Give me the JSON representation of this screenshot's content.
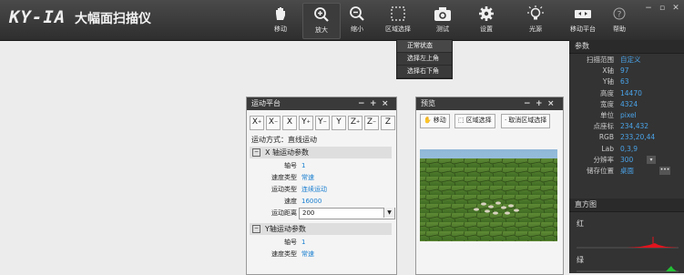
{
  "app": {
    "logo": "KY-IA",
    "name": "大幅面扫描仪"
  },
  "toolbar": [
    {
      "label": "移动",
      "icon": "hand-icon"
    },
    {
      "label": "放大",
      "icon": "zoom-in-icon",
      "active": true
    },
    {
      "label": "缩小",
      "icon": "zoom-out-icon"
    },
    {
      "label": "区域选择",
      "icon": "region-select-icon"
    },
    {
      "label": "测试",
      "icon": "camera-icon"
    },
    {
      "label": "设置",
      "icon": "gear-icon"
    },
    {
      "label": "光源",
      "icon": "bulb-icon"
    },
    {
      "label": "移动平台",
      "icon": "platform-icon"
    },
    {
      "label": "帮助",
      "icon": "help-icon"
    }
  ],
  "window_controls": {
    "minimize": "−",
    "restore": "▫",
    "close": "✕"
  },
  "region_menu": [
    "正常状态",
    "选择左上角",
    "选择右下角"
  ],
  "params": {
    "title": "参数",
    "rows": [
      {
        "key": "扫描范围",
        "value": "自定义"
      },
      {
        "key": "X轴",
        "value": "97"
      },
      {
        "key": "Y轴",
        "value": "63"
      },
      {
        "key": "高度",
        "value": "14470"
      },
      {
        "key": "宽度",
        "value": "4324"
      },
      {
        "key": "单位",
        "value": "pixel"
      },
      {
        "key": "点座标",
        "value": "234,432"
      },
      {
        "key": "RGB",
        "value": "233,20,44"
      },
      {
        "key": "Lab",
        "value": "0,3,9"
      },
      {
        "key": "分辨率",
        "value": "300"
      },
      {
        "key": "储存位置",
        "value": "桌面",
        "more": "•••"
      }
    ]
  },
  "histogram": {
    "title": "直方图",
    "red_label": "红",
    "green_label": "绿",
    "red_color": "#e0141e",
    "green_color": "#22c035"
  },
  "motion": {
    "title": "运动平台",
    "controls": [
      "−",
      "+",
      "×"
    ],
    "axis_buttons": [
      {
        "base": "X",
        "sup": "+"
      },
      {
        "base": "X",
        "sup": "−"
      },
      {
        "base": "X",
        "sup": ""
      },
      {
        "base": "Y",
        "sup": "+"
      },
      {
        "base": "Y",
        "sup": "−"
      },
      {
        "base": "Y",
        "sup": ""
      },
      {
        "base": "Z",
        "sup": "+"
      },
      {
        "base": "Z",
        "sup": "−"
      },
      {
        "base": "Z",
        "sup": ""
      }
    ],
    "mode": "运动方式：直线运动",
    "x_section": "X 轴运动参数",
    "x_rows": [
      {
        "key": "轴号",
        "value": "1"
      },
      {
        "key": "速度类型",
        "value": "常速"
      },
      {
        "key": "运动类型",
        "value": "连续运动"
      },
      {
        "key": "速度",
        "value": "16000"
      },
      {
        "key": "运动距离",
        "value": "200",
        "select": true
      }
    ],
    "y_section": "Y轴运动参数",
    "y_rows": [
      {
        "key": "轴号",
        "value": "1"
      },
      {
        "key": "速度类型",
        "value": "常速"
      }
    ],
    "toggle_symbol": "−"
  },
  "preview": {
    "title": "预览",
    "controls": [
      "−",
      "+",
      "×"
    ],
    "buttons": [
      {
        "label": "移动",
        "icon": "hand-icon"
      },
      {
        "label": "区域选择",
        "icon": "region-select-icon"
      },
      {
        "label": "取消区域选择",
        "icon": "dot-icon"
      }
    ]
  },
  "colors": {
    "accent": "#4aa3e8",
    "link": "#1a7fd0",
    "topbar": "#3a3a3a",
    "panel_dark": "#333333"
  }
}
